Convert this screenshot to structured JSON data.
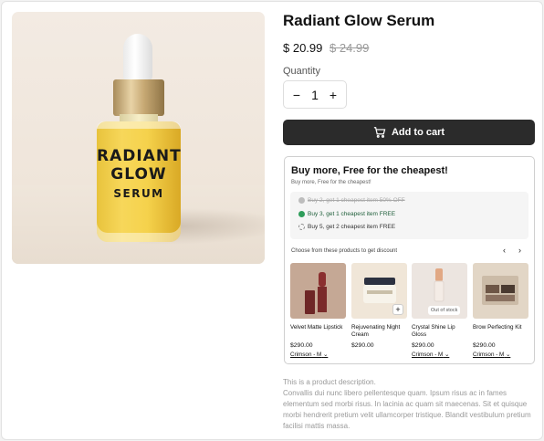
{
  "product": {
    "title": "Radiant Glow Serum",
    "price": "$ 20.99",
    "compare_price": "$ 24.99",
    "bottle_label": [
      "RADIANT",
      "GLOW",
      "SERUM"
    ]
  },
  "quantity": {
    "label": "Quantity",
    "value": "1",
    "minus": "−",
    "plus": "+"
  },
  "cart": {
    "label": "Add to cart"
  },
  "offer": {
    "heading": "Buy more, Free for the cheapest!",
    "subheading": "Buy more, Free for the cheapest!",
    "tiers": [
      {
        "text": "Buy 2, get 1 cheapest item 50% OFF",
        "state": "expired"
      },
      {
        "text": "Buy 3, get 1 cheapest item FREE",
        "state": "active"
      },
      {
        "text": "Buy 5, get 2 cheapest item FREE",
        "state": "pending"
      }
    ],
    "choose_label": "Choose from these products to get discount",
    "prev": "‹",
    "next": "›",
    "products": [
      {
        "name": "Velvet Matte Lipstick",
        "price": "$290.00",
        "variant": "Crimson - M",
        "badge": ""
      },
      {
        "name": "Rejuvenating Night Cream",
        "price": "$290.00",
        "variant": "",
        "badge": "+"
      },
      {
        "name": "Crystal Shine Lip Gloss",
        "price": "$290.00",
        "variant": "Crimson - M",
        "badge": "Out of stock"
      },
      {
        "name": "Brow Perfecting Kit",
        "price": "$290.00",
        "variant": "Crimson - M",
        "badge": ""
      }
    ]
  },
  "description": {
    "line1": "This is a product description.",
    "body": "Convallis dui nunc libero pellentesque quam. Ipsum risus ac in fames elementum sed morbi risus. In lacinia ac quam sit maecenas. Sit et quisque morbi hendrerit pretium velit ullamcorper tristique. Blandit vestibulum pretium facilisi mattis massa."
  },
  "colors": {
    "button": "#2b2b2b",
    "active_tier": "#2e9d5a",
    "muted": "#9a9a9a"
  }
}
